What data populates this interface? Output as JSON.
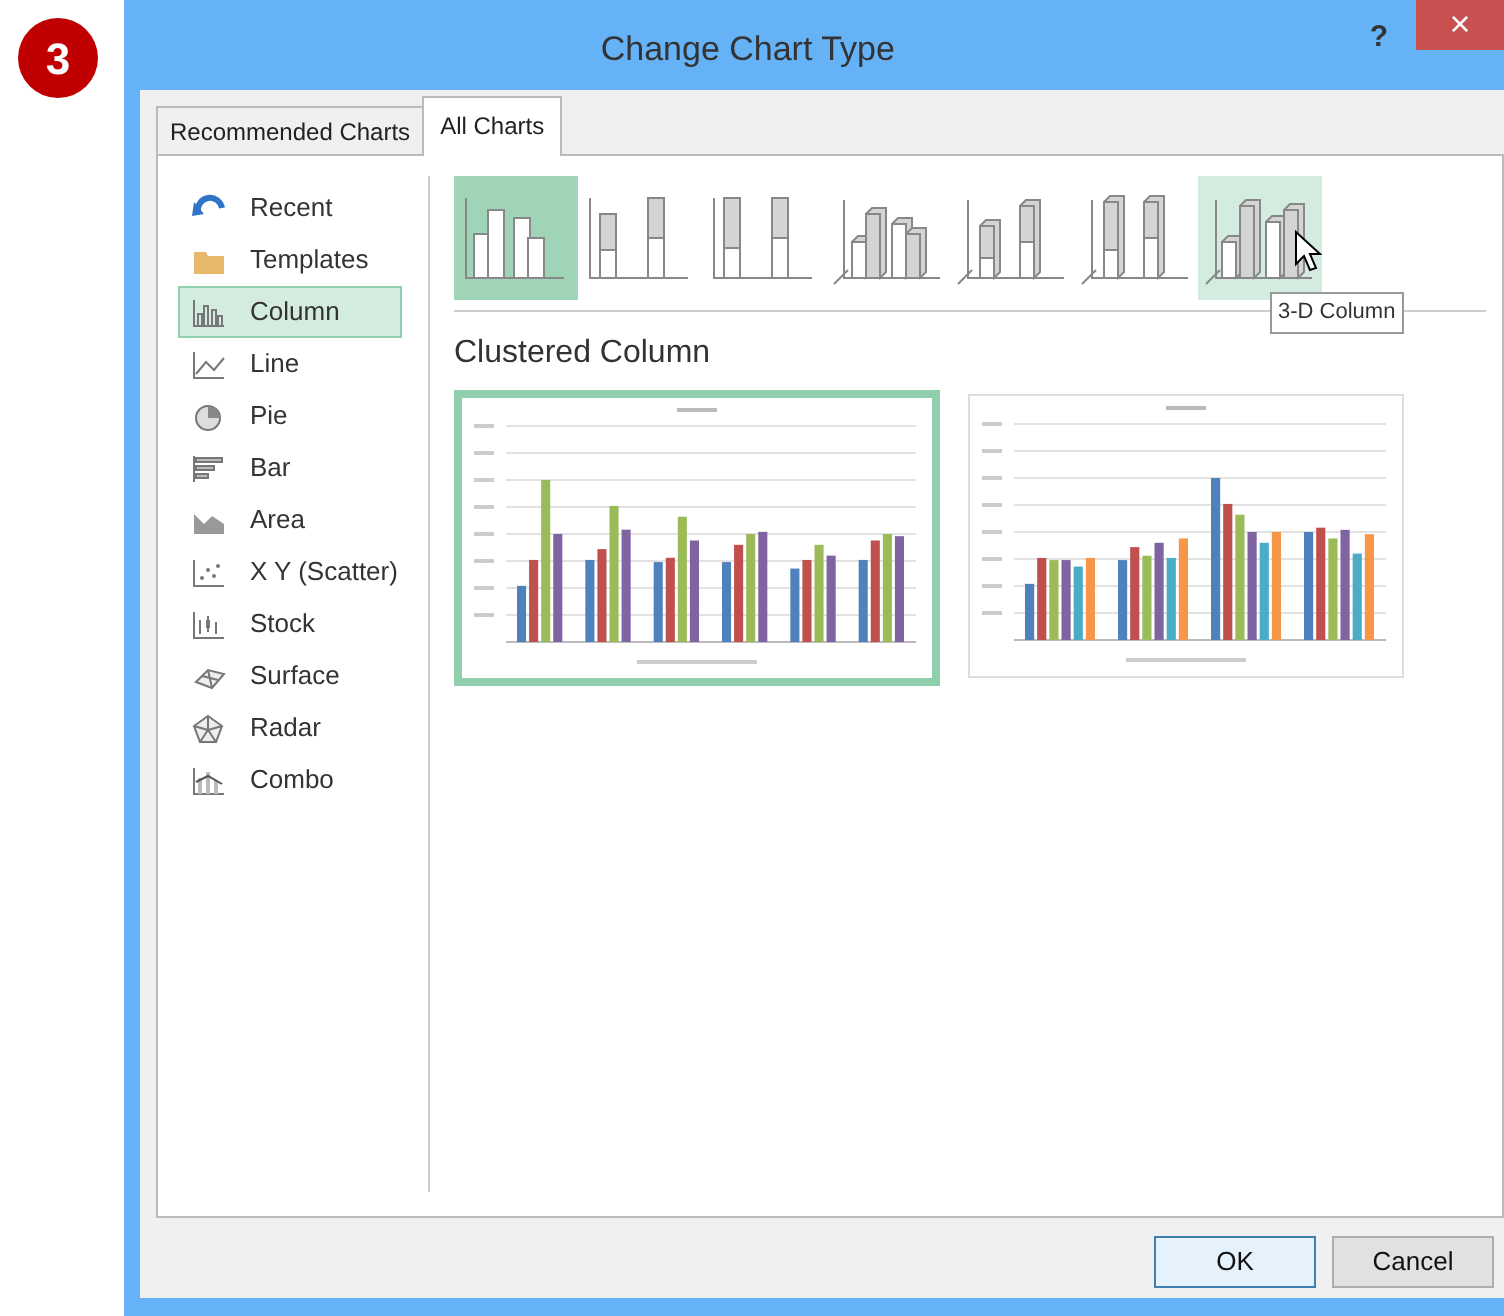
{
  "step_badge": "3",
  "window": {
    "title": "Change Chart Type",
    "help": "?",
    "close": "×"
  },
  "tabs": [
    {
      "label": "Recommended Charts",
      "selected": false
    },
    {
      "label": "All Charts",
      "selected": true
    }
  ],
  "sidebar": {
    "items": [
      {
        "label": "Recent",
        "kind": "recent",
        "selected": false
      },
      {
        "label": "Templates",
        "kind": "templates",
        "selected": false
      },
      {
        "label": "Column",
        "kind": "column",
        "selected": true
      },
      {
        "label": "Line",
        "kind": "line",
        "selected": false
      },
      {
        "label": "Pie",
        "kind": "pie",
        "selected": false
      },
      {
        "label": "Bar",
        "kind": "bar",
        "selected": false
      },
      {
        "label": "Area",
        "kind": "area",
        "selected": false
      },
      {
        "label": "X Y (Scatter)",
        "kind": "scatter",
        "selected": false
      },
      {
        "label": "Stock",
        "kind": "stock",
        "selected": false
      },
      {
        "label": "Surface",
        "kind": "surface",
        "selected": false
      },
      {
        "label": "Radar",
        "kind": "radar",
        "selected": false
      },
      {
        "label": "Combo",
        "kind": "combo",
        "selected": false
      }
    ]
  },
  "subtypes": [
    {
      "kind": "clustered",
      "selected": true,
      "hovered": false
    },
    {
      "kind": "stacked",
      "selected": false,
      "hovered": false
    },
    {
      "kind": "stacked100",
      "selected": false,
      "hovered": false
    },
    {
      "kind": "clustered3d",
      "selected": false,
      "hovered": false
    },
    {
      "kind": "stacked3d",
      "selected": false,
      "hovered": false
    },
    {
      "kind": "stacked100_3d",
      "selected": false,
      "hovered": false
    },
    {
      "kind": "column3d",
      "selected": false,
      "hovered": true
    }
  ],
  "tooltip": "3-D Column",
  "subtype_title": "Clustered Column",
  "previews": [
    {
      "kind": "by_row",
      "selected": true
    },
    {
      "kind": "by_column",
      "selected": false
    }
  ],
  "buttons": [
    {
      "label": "OK",
      "kind": "default"
    },
    {
      "label": "Cancel",
      "kind": "normal"
    }
  ]
}
